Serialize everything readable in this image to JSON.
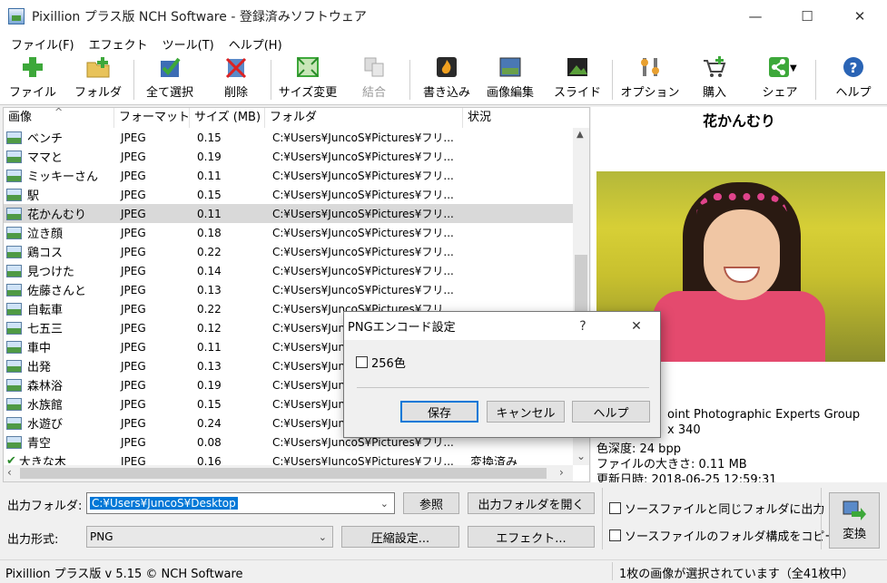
{
  "window": {
    "title": "Pixillion プラス版 NCH Software - 登録済みソフトウェア",
    "minimize": "—",
    "maximize": "☐",
    "close": "✕"
  },
  "menu": [
    "ファイル(F)",
    "エフェクト",
    "ツール(T)",
    "ヘルプ(H)"
  ],
  "toolbar": [
    {
      "label": "ファイル",
      "icon": "add-file-icon"
    },
    {
      "label": "フォルダ",
      "icon": "add-folder-icon"
    },
    {
      "label": "全て選択",
      "icon": "select-all-icon"
    },
    {
      "label": "削除",
      "icon": "delete-icon"
    },
    {
      "label": "サイズ変更",
      "icon": "resize-icon"
    },
    {
      "label": "結合",
      "icon": "merge-icon"
    },
    {
      "label": "書き込み",
      "icon": "burn-icon"
    },
    {
      "label": "画像編集",
      "icon": "image-edit-icon"
    },
    {
      "label": "スライド",
      "icon": "slideshow-icon"
    },
    {
      "label": "オプション",
      "icon": "options-icon"
    },
    {
      "label": "購入",
      "icon": "cart-icon"
    },
    {
      "label": "シェア",
      "icon": "share-icon"
    },
    {
      "label": "ヘルプ",
      "icon": "help-icon"
    }
  ],
  "list": {
    "columns": [
      "画像",
      "フォーマット",
      "サイズ (MB)",
      "フォルダ",
      "状況"
    ],
    "rows": [
      {
        "name": "ベンチ",
        "format": "JPEG",
        "size": "0.15",
        "folder": "C:¥Users¥JuncoS¥Pictures¥フリ...",
        "status": ""
      },
      {
        "name": "ママと",
        "format": "JPEG",
        "size": "0.19",
        "folder": "C:¥Users¥JuncoS¥Pictures¥フリ...",
        "status": ""
      },
      {
        "name": "ミッキーさん",
        "format": "JPEG",
        "size": "0.11",
        "folder": "C:¥Users¥JuncoS¥Pictures¥フリ...",
        "status": ""
      },
      {
        "name": "駅",
        "format": "JPEG",
        "size": "0.15",
        "folder": "C:¥Users¥JuncoS¥Pictures¥フリ...",
        "status": ""
      },
      {
        "name": "花かんむり",
        "format": "JPEG",
        "size": "0.11",
        "folder": "C:¥Users¥JuncoS¥Pictures¥フリ...",
        "status": ""
      },
      {
        "name": "泣き顔",
        "format": "JPEG",
        "size": "0.18",
        "folder": "C:¥Users¥JuncoS¥Pictures¥フリ...",
        "status": ""
      },
      {
        "name": "鶏コス",
        "format": "JPEG",
        "size": "0.22",
        "folder": "C:¥Users¥JuncoS¥Pictures¥フリ...",
        "status": ""
      },
      {
        "name": "見つけた",
        "format": "JPEG",
        "size": "0.14",
        "folder": "C:¥Users¥JuncoS¥Pictures¥フリ...",
        "status": ""
      },
      {
        "name": "佐藤さんと",
        "format": "JPEG",
        "size": "0.13",
        "folder": "C:¥Users¥JuncoS¥Pictures¥フリ...",
        "status": ""
      },
      {
        "name": "自転車",
        "format": "JPEG",
        "size": "0.22",
        "folder": "C:¥Users¥JuncoS¥Pictures¥フリ...",
        "status": ""
      },
      {
        "name": "七五三",
        "format": "JPEG",
        "size": "0.12",
        "folder": "C:¥Users¥JuncoS¥Pictures¥フリ...",
        "status": ""
      },
      {
        "name": "車中",
        "format": "JPEG",
        "size": "0.11",
        "folder": "C:¥Users¥JuncoS¥Pictures¥フリ...",
        "status": ""
      },
      {
        "name": "出発",
        "format": "JPEG",
        "size": "0.13",
        "folder": "C:¥Users¥JuncoS¥Pictures¥フリ...",
        "status": ""
      },
      {
        "name": "森林浴",
        "format": "JPEG",
        "size": "0.19",
        "folder": "C:¥Users¥JuncoS¥Pictures¥フリ...",
        "status": ""
      },
      {
        "name": "水族館",
        "format": "JPEG",
        "size": "0.15",
        "folder": "C:¥Users¥JuncoS¥Pictures¥フリ...",
        "status": ""
      },
      {
        "name": "水遊び",
        "format": "JPEG",
        "size": "0.24",
        "folder": "C:¥Users¥JuncoS¥Pictures¥フリ...",
        "status": ""
      },
      {
        "name": "青空",
        "format": "JPEG",
        "size": "0.08",
        "folder": "C:¥Users¥JuncoS¥Pictures¥フリ...",
        "status": ""
      },
      {
        "name": "大きな木",
        "format": "JPEG",
        "size": "0.16",
        "folder": "C:¥Users¥JuncoS¥Pictures¥フリ...",
        "status": "変換済み"
      }
    ],
    "selected_index": 4
  },
  "preview": {
    "title": "花かんむり",
    "info": [
      "oint Photographic Experts Group",
      "x 340",
      "色深度: 24 bpp",
      "ファイルの大きさ: 0.11 MB",
      "更新日時: 2018-06-25 12:59:31"
    ]
  },
  "bottom": {
    "output_folder_label": "出力フォルダ:",
    "output_folder_value": "C:¥Users¥JuncoS¥Desktop",
    "browse_button": "参照",
    "open_folder_button": "出力フォルダを開く",
    "output_format_label": "出力形式:",
    "output_format_value": "PNG",
    "compression_button": "圧縮設定...",
    "effects_button": "エフェクト...",
    "same_folder_checkbox": "ソースファイルと同じフォルダに出力",
    "copy_structure_checkbox": "ソースファイルのフォルダ構成をコピー",
    "convert_button": "変換"
  },
  "status": {
    "left": "Pixillion プラス版 v 5.15 © NCH Software",
    "right": "1枚の画像が選択されています（全41枚中）"
  },
  "dialog": {
    "title": "PNGエンコード設定",
    "help_glyph": "?",
    "close_glyph": "✕",
    "checkbox_label": "256色",
    "save_button": "保存",
    "cancel_button": "キャンセル",
    "help_button": "ヘルプ"
  },
  "colors": {
    "accent": "#0078d7",
    "selection": "#d9d9d9",
    "dialog_default_border": "#0078d7"
  }
}
